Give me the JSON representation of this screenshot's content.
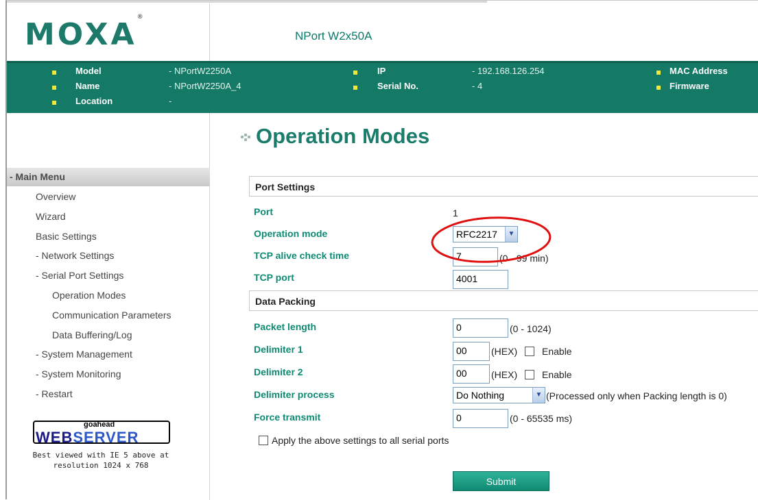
{
  "header": {
    "logo": "MOXA",
    "logo_mark": "®",
    "product": "NPort W2x50A"
  },
  "info": {
    "left": [
      {
        "label": "Model",
        "value": "- NPortW2250A"
      },
      {
        "label": "Name",
        "value": "- NPortW2250A_4"
      },
      {
        "label": "Location",
        "value": "-"
      }
    ],
    "middle": [
      {
        "label": "IP",
        "value": "- 192.168.126.254"
      },
      {
        "label": "Serial No.",
        "value": "- 4"
      }
    ],
    "right": [
      {
        "label": "MAC Address"
      },
      {
        "label": "Firmware"
      }
    ]
  },
  "nav": {
    "heading": "- Main Menu",
    "items": [
      "Overview",
      "Wizard",
      "Basic Settings",
      "- Network Settings",
      "- Serial Port Settings",
      "Operation Modes",
      "Communication Parameters",
      "Data Buffering/Log",
      "- System Management",
      "- System Monitoring",
      "- Restart"
    ],
    "webserver": {
      "top": "goahead",
      "part1": "WEB",
      "part2": "SERVER"
    },
    "note_line1": "Best viewed with IE 5 above at",
    "note_line2": "resolution 1024 x 768"
  },
  "page": {
    "title": "Operation Modes",
    "port_settings": "Port Settings",
    "port_label": "Port",
    "port_value": "1",
    "op_mode_label": "Operation mode",
    "op_mode_value": "RFC2217",
    "tcp_alive_label": "TCP alive check time",
    "tcp_alive_value": "7",
    "tcp_alive_hint": "(0 - 99 min)",
    "tcp_port_label": "TCP port",
    "tcp_port_value": "4001",
    "data_packing": "Data Packing",
    "packet_length_label": "Packet length",
    "packet_length_value": "0",
    "packet_length_hint": "(0 - 1024)",
    "delim1_label": "Delimiter 1",
    "delim1_value": "00",
    "delim2_label": "Delimiter 2",
    "delim2_value": "00",
    "hex_hint": "(HEX)",
    "enable_label": "Enable",
    "delim_process_label": "Delimiter process",
    "delim_process_value": "Do Nothing",
    "delim_process_hint": "(Processed only when Packing length is 0)",
    "force_transmit_label": "Force transmit",
    "force_transmit_value": "0",
    "force_transmit_hint": "(0 - 65535 ms)",
    "apply_all_label": "Apply the above settings to all serial ports",
    "submit_label": "Submit"
  },
  "colors": {
    "brand_green": "#147a66",
    "label_green": "#0e8a72",
    "highlight_red": "#e01010"
  }
}
